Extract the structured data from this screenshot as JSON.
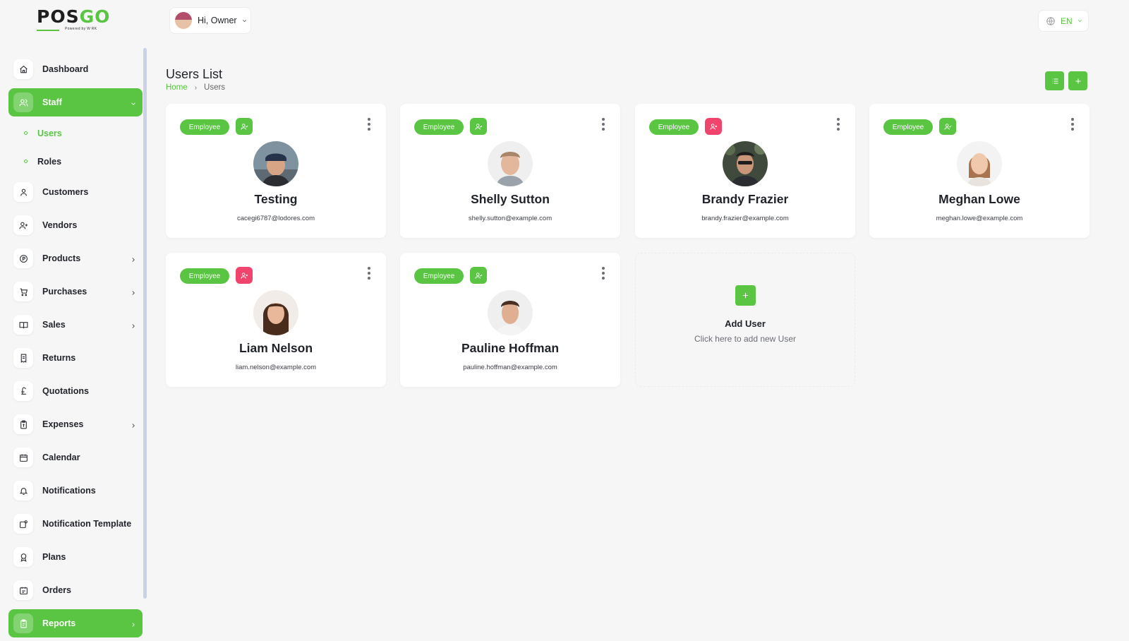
{
  "brand": {
    "name_part1": "POS",
    "name_part2": "GO",
    "tagline": "Powered by W RK"
  },
  "topbar": {
    "greeting": "Hi, Owner",
    "language": "EN"
  },
  "sidebar": {
    "items": [
      {
        "label": "Dashboard",
        "icon": "home-icon"
      },
      {
        "label": "Staff",
        "icon": "users-icon",
        "active": true
      },
      {
        "label": "Users",
        "sub": true,
        "current": true
      },
      {
        "label": "Roles",
        "sub": true
      },
      {
        "label": "Customers",
        "icon": "user-icon"
      },
      {
        "label": "Vendors",
        "icon": "user-plus-icon"
      },
      {
        "label": "Products",
        "icon": "product-icon",
        "expandable": true
      },
      {
        "label": "Purchases",
        "icon": "cart-icon",
        "expandable": true
      },
      {
        "label": "Sales",
        "icon": "book-icon",
        "expandable": true
      },
      {
        "label": "Returns",
        "icon": "receipt-icon"
      },
      {
        "label": "Quotations",
        "icon": "pound-icon"
      },
      {
        "label": "Expenses",
        "icon": "expense-icon",
        "expandable": true
      },
      {
        "label": "Calendar",
        "icon": "calendar-icon"
      },
      {
        "label": "Notifications",
        "icon": "bell-icon"
      },
      {
        "label": "Notification Template",
        "icon": "template-icon"
      },
      {
        "label": "Plans",
        "icon": "award-icon"
      },
      {
        "label": "Orders",
        "icon": "orders-icon"
      },
      {
        "label": "Reports",
        "icon": "report-icon",
        "expandable": true,
        "active": true
      }
    ]
  },
  "header": {
    "title": "Users List",
    "breadcrumb_home": "Home",
    "breadcrumb_current": "Users"
  },
  "users": [
    {
      "role": "Employee",
      "name": "Testing",
      "email": "cacegi6787@lodores.com",
      "status": "green"
    },
    {
      "role": "Employee",
      "name": "Shelly Sutton",
      "email": "shelly.sutton@example.com",
      "status": "green"
    },
    {
      "role": "Employee",
      "name": "Brandy Frazier",
      "email": "brandy.frazier@example.com",
      "status": "red"
    },
    {
      "role": "Employee",
      "name": "Meghan Lowe",
      "email": "meghan.lowe@example.com",
      "status": "green"
    },
    {
      "role": "Employee",
      "name": "Liam Nelson",
      "email": "liam.nelson@example.com",
      "status": "red"
    },
    {
      "role": "Employee",
      "name": "Pauline Hoffman",
      "email": "pauline.hoffman@example.com",
      "status": "green"
    }
  ],
  "add_user": {
    "title": "Add User",
    "subtitle": "Click here to add new User"
  },
  "colors": {
    "accent": "#5ac543",
    "danger": "#f0446c"
  }
}
